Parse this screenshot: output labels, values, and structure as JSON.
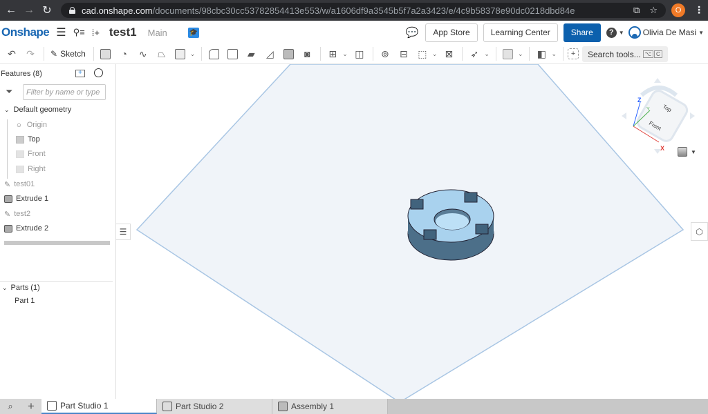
{
  "browser": {
    "url_host": "cad.onshape.com",
    "url_path": "/documents/98cbc30cc53782854413e553/w/a1606df9a3545b5f7a2a3423/e/4c9b58378e90dc0218dbd84e",
    "profile_initial": "O",
    "icons": [
      "back-arrow-icon",
      "forward-arrow-icon",
      "reload-icon",
      "lock-icon",
      "translate-icon",
      "bookmark-star-icon",
      "menu-kebab-icon"
    ]
  },
  "header": {
    "logo": "Onshape",
    "document_title": "test1",
    "branch": "Main",
    "buttons": {
      "app_store": "App Store",
      "learning_center": "Learning Center",
      "share": "Share"
    },
    "help_label": "?",
    "user_name": "Olivia De Masi",
    "colors": {
      "brand": "#1967b3",
      "share_bg": "#0c60ad"
    }
  },
  "toolbar": {
    "undo": "↶",
    "redo": "↷",
    "sketch_label": "Sketch",
    "search_tools_label": "Search tools...",
    "search_shortcut": [
      "⌥",
      "C"
    ],
    "tools": [
      "extrude",
      "revolve",
      "sweep",
      "loft",
      "thicken",
      "fillet",
      "chamfer",
      "draft",
      "rib",
      "shell",
      "hole",
      "pattern",
      "mirror",
      "boolean",
      "split",
      "transform",
      "delete-part",
      "modify",
      "plane",
      "mate-connector",
      "add-custom-feature"
    ]
  },
  "features_panel": {
    "title": "Features (8)",
    "filter_placeholder": "Filter by name or type",
    "default_geometry_label": "Default geometry",
    "items": [
      {
        "label": "Origin",
        "type": "origin",
        "muted": true
      },
      {
        "label": "Top",
        "type": "plane",
        "muted": false
      },
      {
        "label": "Front",
        "type": "plane",
        "muted": true
      },
      {
        "label": "Right",
        "type": "plane",
        "muted": true
      },
      {
        "label": "test01",
        "type": "sketch",
        "muted": true
      },
      {
        "label": "Extrude 1",
        "type": "extrude",
        "muted": false
      },
      {
        "label": "test2",
        "type": "sketch",
        "muted": true
      },
      {
        "label": "Extrude 2",
        "type": "extrude",
        "muted": false
      }
    ],
    "parts_label": "Parts (1)",
    "parts": [
      "Part 1"
    ]
  },
  "viewcube": {
    "faces": [
      "Top",
      "Front"
    ],
    "axes": {
      "x": "X",
      "y": "Y",
      "z": "Z"
    },
    "axis_colors": {
      "x": "#e0403a",
      "y": "#4caf50",
      "z": "#2962ff"
    }
  },
  "bottom_tabs": [
    {
      "label": "Part Studio 1",
      "active": true
    },
    {
      "label": "Part Studio 2",
      "active": false
    },
    {
      "label": "Assembly 1",
      "active": false
    }
  ]
}
